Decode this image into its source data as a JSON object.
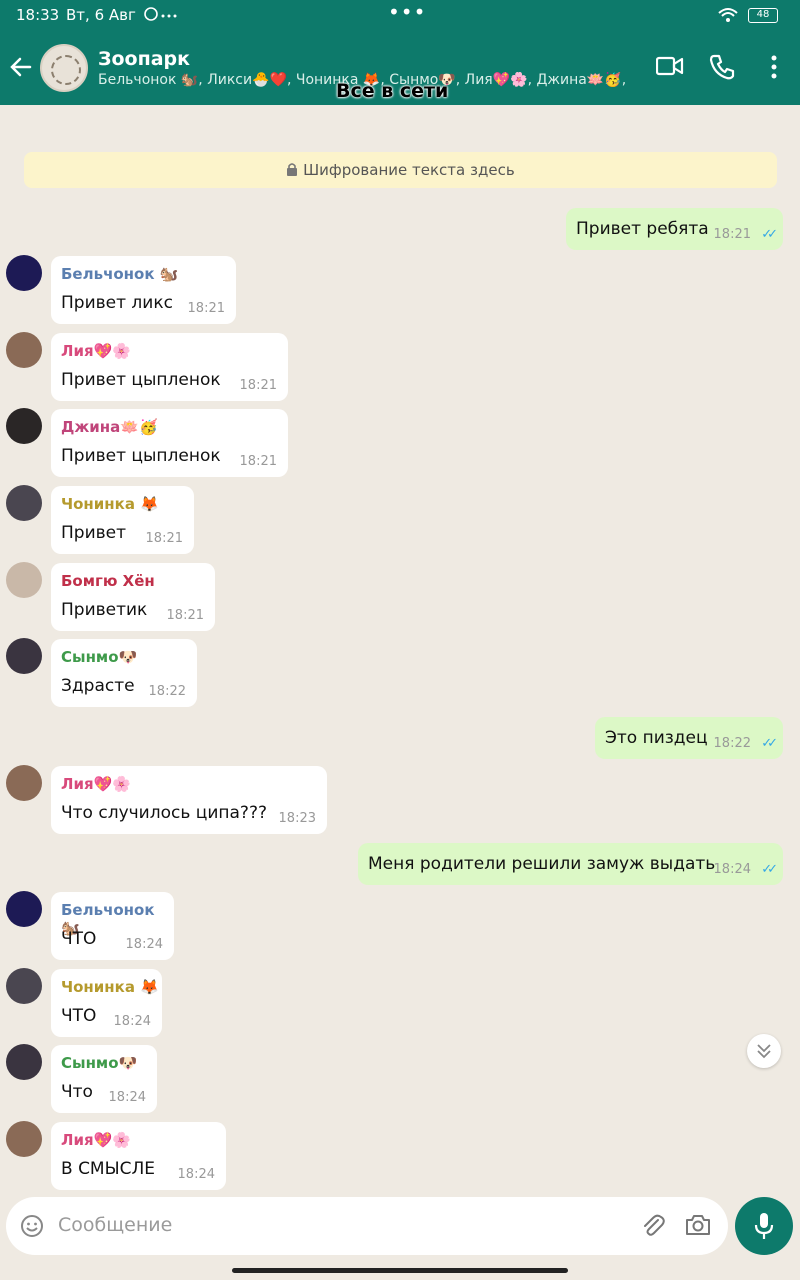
{
  "status_bar": {
    "time": "18:33",
    "date": "Вт, 6 Авг",
    "battery": "48"
  },
  "header": {
    "title": "Зоопарк",
    "subtitle": "Бельчонок 🐿️, Ликси🐣❤️, Чонинка 🦊, Сынмо🐶, Лия💖🌸, Джина🪷🥳, ..",
    "overlay": "Все в сети"
  },
  "banner": "Шифрование текста здесь",
  "messages": [
    {
      "sender": "",
      "text": "Привет ребята",
      "time": "18:21"
    },
    {
      "sender": "Бельчонок 🐿️",
      "text": "Привет ликс",
      "time": "18:21"
    },
    {
      "sender": "Лия💖🌸",
      "text": "Привет цыпленок",
      "time": "18:21"
    },
    {
      "sender": "Джина🪷🥳",
      "text": "Привет цыпленок",
      "time": "18:21"
    },
    {
      "sender": "Чонинка 🦊",
      "text": "Привет",
      "time": "18:21"
    },
    {
      "sender": "Бомгю Хён",
      "text": "Приветик",
      "time": "18:21"
    },
    {
      "sender": "Сынмо🐶",
      "text": "Здрасте",
      "time": "18:22"
    },
    {
      "sender": "",
      "text": "Это пиздец",
      "time": "18:22"
    },
    {
      "sender": "Лия💖🌸",
      "text": "Что случилось ципа???",
      "time": "18:23"
    },
    {
      "sender": "",
      "text": "Меня родители решили замуж выдать",
      "time": "18:24"
    },
    {
      "sender": "Бельчонок 🐿️",
      "text": "ЧТО",
      "time": "18:24"
    },
    {
      "sender": "Чонинка 🦊",
      "text": "ЧТО",
      "time": "18:24"
    },
    {
      "sender": "Сынмо🐶",
      "text": "Что",
      "time": "18:24"
    },
    {
      "sender": "Лия💖🌸",
      "text": "В СМЫСЛЕ",
      "time": "18:24"
    }
  ],
  "composer": {
    "placeholder": "Сообщение"
  },
  "colors": {
    "header": "#0d7a6b",
    "chat_bg": "#efeae2",
    "outgoing": "#dcf8c6",
    "banner": "#fcf4cb",
    "name_belchonok": "#5b7fb0",
    "name_liya": "#d84a7c",
    "name_jina": "#c0457a",
    "name_choninka": "#b59a2d",
    "name_bomgyu": "#c0304a",
    "name_synmo": "#3e9a4a"
  }
}
